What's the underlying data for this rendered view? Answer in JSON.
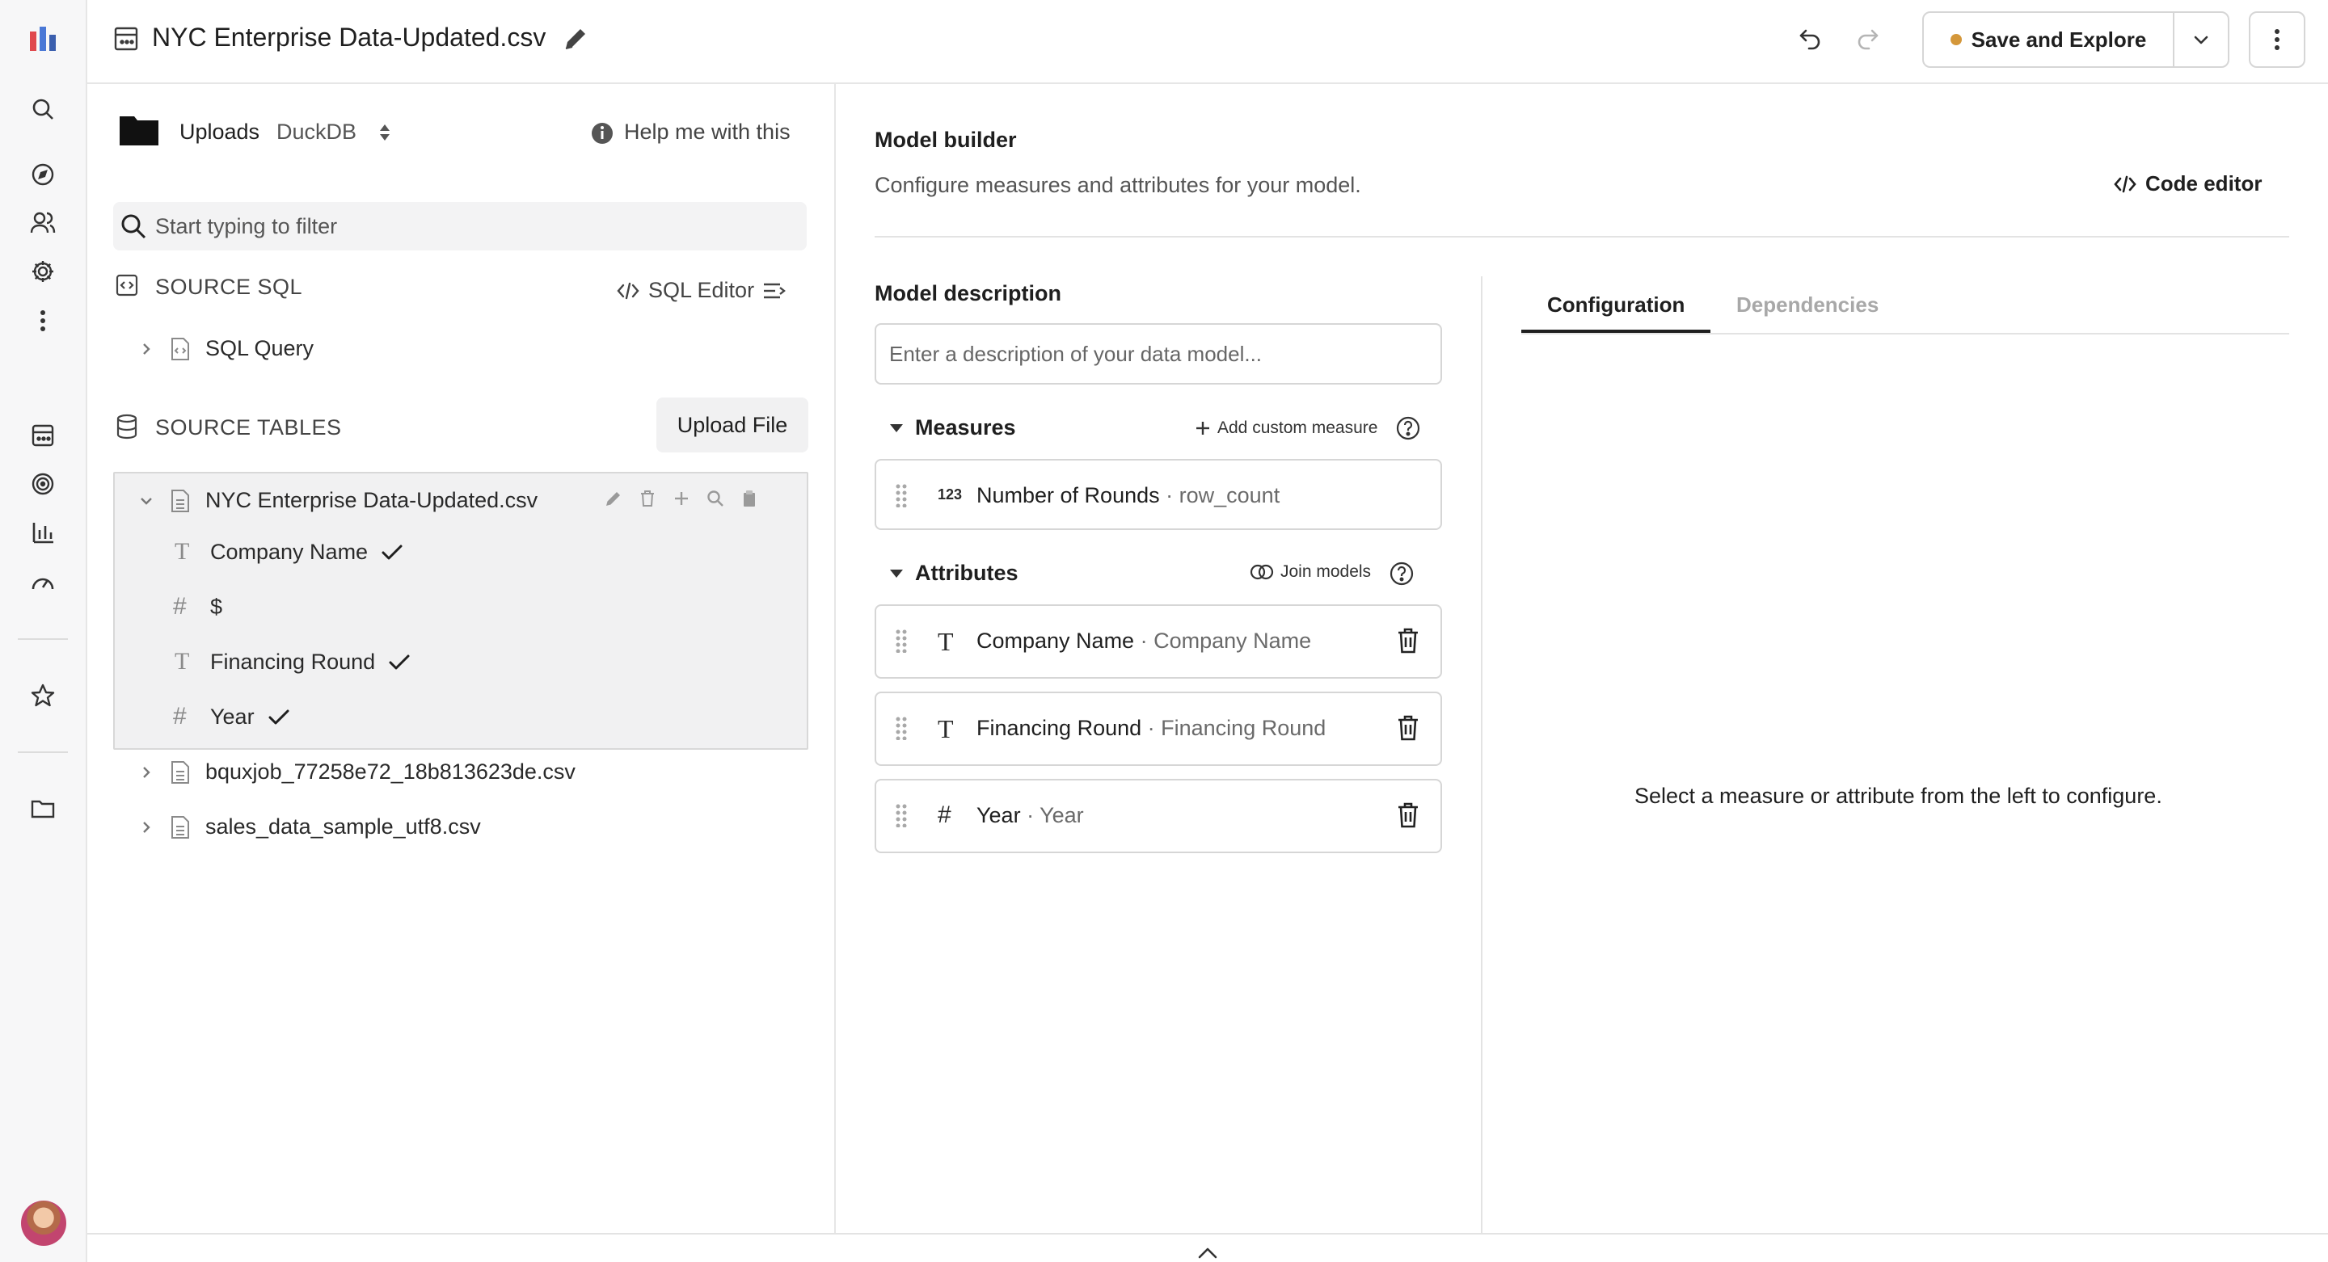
{
  "header": {
    "title": "NYC Enterprise Data-Updated.csv",
    "save_label": "Save and Explore",
    "save_status_color": "#d4973a"
  },
  "rail": {
    "icons": [
      "logo-icon",
      "search-icon",
      "compass-icon",
      "people-icon",
      "gear-icon",
      "more-vertical-icon",
      "dataset-icon",
      "target-icon",
      "bar-chart-icon",
      "gauge-icon",
      "star-icon",
      "folder-icon",
      "avatar"
    ]
  },
  "source": {
    "connection": "Uploads",
    "engine": "DuckDB",
    "help_label": "Help me with this",
    "filter_placeholder": "Start typing to filter",
    "sql_section_label": "SOURCE SQL",
    "sql_editor_label": "SQL Editor",
    "sql_query_label": "SQL Query",
    "tables_section_label": "SOURCE TABLES",
    "upload_label": "Upload File",
    "tables": [
      {
        "name": "NYC Enterprise Data-Updated.csv",
        "expanded": true,
        "columns": [
          {
            "name": "Company Name",
            "type": "text",
            "selected": true
          },
          {
            "name": "$",
            "type": "number",
            "selected": false
          },
          {
            "name": "Financing Round",
            "type": "text",
            "selected": true
          },
          {
            "name": "Year",
            "type": "number",
            "selected": true
          }
        ]
      },
      {
        "name": "bquxjob_77258e72_18b813623de.csv",
        "expanded": false
      },
      {
        "name": "sales_data_sample_utf8.csv",
        "expanded": false
      }
    ]
  },
  "builder": {
    "title": "Model builder",
    "subtitle": "Configure measures and attributes for your model.",
    "code_editor_label": "Code editor",
    "description_label": "Model description",
    "description_placeholder": "Enter a description of your data model...",
    "measures_label": "Measures",
    "add_measure_label": "Add custom measure",
    "measures": [
      {
        "icon": "123",
        "name": "Number of Rounds",
        "column": "row_count"
      }
    ],
    "attributes_label": "Attributes",
    "join_label": "Join models",
    "separator": " · ",
    "attributes": [
      {
        "icon": "T",
        "name": "Company Name",
        "column": "Company Name"
      },
      {
        "icon": "T",
        "name": "Financing Round",
        "column": "Financing Round"
      },
      {
        "icon": "#",
        "name": "Year",
        "column": "Year"
      }
    ]
  },
  "config": {
    "tabs": [
      "Configuration",
      "Dependencies"
    ],
    "active_tab": "Configuration",
    "empty_text": "Select a measure or attribute from the left to configure."
  }
}
